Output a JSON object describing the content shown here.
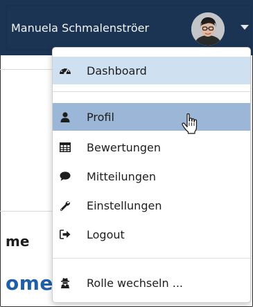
{
  "header": {
    "user_name": "Manuela Schmalenströer",
    "avatar_icon": "user-avatar-photo",
    "caret_icon": "caret-down-icon"
  },
  "menu": {
    "items": [
      {
        "label": "Dashboard",
        "icon": "dashboard-gauge-icon",
        "state": "highlighted"
      },
      {
        "label": "Profil",
        "icon": "user-icon",
        "state": "hovered"
      },
      {
        "label": "Bewertungen",
        "icon": "table-grid-icon",
        "state": "normal"
      },
      {
        "label": "Mitteilungen",
        "icon": "comment-bubble-icon",
        "state": "normal"
      },
      {
        "label": "Einstellungen",
        "icon": "wrench-icon",
        "state": "normal"
      },
      {
        "label": "Logout",
        "icon": "sign-out-icon",
        "state": "normal"
      },
      {
        "label": "Rolle wechseln ...",
        "icon": "user-secret-icon",
        "state": "normal"
      }
    ]
  },
  "background": {
    "heading_fragment": "me",
    "title_fragment": "ome"
  },
  "colors": {
    "topbar": "#1b3454",
    "highlight_light": "#cfe0f0",
    "highlight_hover": "#9cb6d8",
    "title_blue": "#1f5fa8"
  },
  "cursor": "hand-pointer-cursor"
}
